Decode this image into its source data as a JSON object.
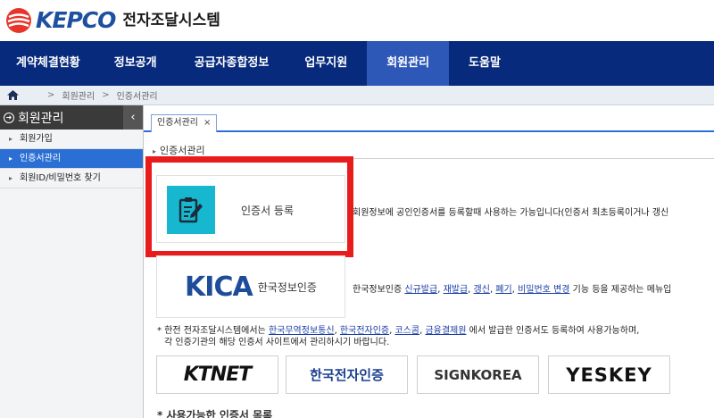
{
  "header": {
    "logo_word": "KEPCO",
    "system_name": "전자조달시스템"
  },
  "gnb": {
    "items": [
      {
        "label": "계약체결현황"
      },
      {
        "label": "정보공개"
      },
      {
        "label": "공급자종합정보"
      },
      {
        "label": "업무지원"
      },
      {
        "label": "회원관리",
        "active": true
      },
      {
        "label": "도움말"
      }
    ]
  },
  "breadcrumb": {
    "items": [
      "회원관리",
      "인증서관리"
    ]
  },
  "sidebar": {
    "title": "회원관리",
    "toggle": "‹",
    "items": [
      {
        "label": "회원가입"
      },
      {
        "label": "인증서관리",
        "active": true
      },
      {
        "label": "회원ID/비밀번호 찾기"
      }
    ]
  },
  "tab": {
    "label": "인증서관리",
    "close": "×"
  },
  "page": {
    "title": "인증서관리",
    "register_card_label": "인증서 등록",
    "register_desc": "회원정보에 공인인증서를 등록할때 사용하는 가능입니다(인증서 최초등록이거나 갱신",
    "kica": {
      "logo_word": "KICA",
      "logo_sub": "한국정보인증"
    },
    "kica_desc": {
      "prefix": "한국정보인증",
      "links": [
        "신규발급",
        "재발급",
        "갱신",
        "폐기",
        "비밀번호 변경"
      ],
      "suffix": "기능 등을 제공하는 메뉴입"
    },
    "note": {
      "line1_prefix": "* 한전 전자조달시스템에서는",
      "links": [
        "한국무역정보통신",
        "한국전자인증",
        "코스콤",
        "금융결제원"
      ],
      "line1_suffix": "에서 발급한 인증서도 등록하여 사용가능하며,",
      "line2": "각 인증기관의 해당 인증서 사이트에서 관리하시기 바랍니다."
    },
    "ca_logos": [
      "KTNET",
      "한국전자인증",
      "SIGNKOREA",
      "YESKEY"
    ],
    "sub_title": "* 사용가능한 인증서 목록"
  },
  "colors": {
    "gnb_bg": "#072a7c",
    "gnb_active": "#2d58b8",
    "side_active": "#2c6fd4",
    "card_icon": "#17b7d0",
    "highlight": "#e81c1c"
  }
}
